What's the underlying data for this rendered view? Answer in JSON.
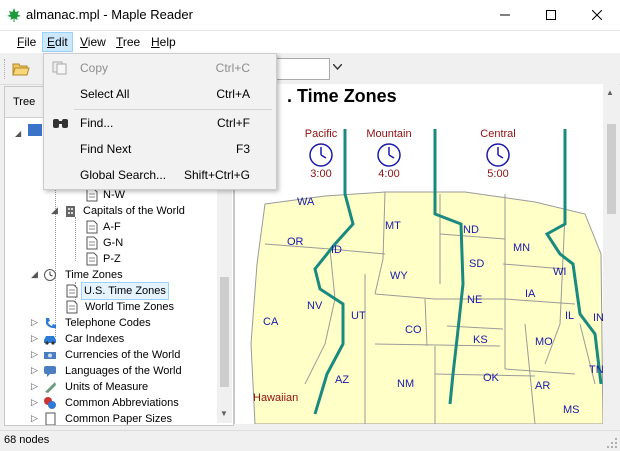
{
  "window": {
    "title": "almanac.mpl - Maple Reader"
  },
  "menubar": {
    "items": [
      "File",
      "Edit",
      "View",
      "Tree",
      "Help"
    ],
    "active": "Edit"
  },
  "edit_menu": {
    "items": [
      {
        "label": "Copy",
        "shortcut": "Ctrl+C",
        "enabled": false
      },
      {
        "label": "Select All",
        "shortcut": "Ctrl+A",
        "enabled": true
      },
      {
        "label": "Find...",
        "shortcut": "Ctrl+F",
        "enabled": true
      },
      {
        "label": "Find Next",
        "shortcut": "F3",
        "enabled": true
      },
      {
        "label": "Global Search...",
        "shortcut": "Shift+Ctrl+G",
        "enabled": true
      }
    ]
  },
  "tree_header": {
    "label": "Tree"
  },
  "tree": {
    "items": [
      {
        "label": "N-W",
        "icon": "document-icon"
      },
      {
        "label": "Capitals of the World",
        "icon": "building-icon"
      },
      {
        "label": "A-F",
        "icon": "document-icon"
      },
      {
        "label": "G-N",
        "icon": "document-icon"
      },
      {
        "label": "P-Z",
        "icon": "document-icon"
      },
      {
        "label": "Time Zones",
        "icon": "clock-icon"
      },
      {
        "label": "U.S. Time Zones",
        "icon": "document-icon",
        "selected": true
      },
      {
        "label": "World Time Zones",
        "icon": "document-icon"
      },
      {
        "label": "Telephone Codes",
        "icon": "telephone-icon"
      },
      {
        "label": "Car Indexes",
        "icon": "car-icon"
      },
      {
        "label": "Currencies of the World",
        "icon": "coins-icon"
      },
      {
        "label": "Languages of the World",
        "icon": "speech-icon"
      },
      {
        "label": "Units of Measure",
        "icon": "ruler-icon"
      },
      {
        "label": "Common Abbreviations",
        "icon": "abbreviation-icon"
      },
      {
        "label": "Common Paper Sizes",
        "icon": "paper-icon"
      }
    ]
  },
  "content": {
    "heading": ". Time Zones",
    "zones": [
      {
        "name": "Pacific",
        "time": "3:00"
      },
      {
        "name": "Mountain",
        "time": "4:00"
      },
      {
        "name": "Central",
        "time": "5:00"
      }
    ],
    "hawaiian_label": "Hawaiian",
    "states": [
      "WA",
      "MT",
      "ND",
      "OR",
      "ID",
      "SD",
      "MN",
      "WI",
      "WY",
      "NE",
      "IA",
      "NV",
      "UT",
      "CO",
      "KS",
      "IL",
      "IN",
      "CA",
      "MO",
      "AZ",
      "NM",
      "OK",
      "AR",
      "TN",
      "MS"
    ],
    "colors": {
      "land": "#ffffc8",
      "border": "#9a9a9a",
      "zone_line": "#1a8a80",
      "state_text": "#1a1aaa"
    }
  },
  "status": {
    "text": "68 nodes"
  }
}
